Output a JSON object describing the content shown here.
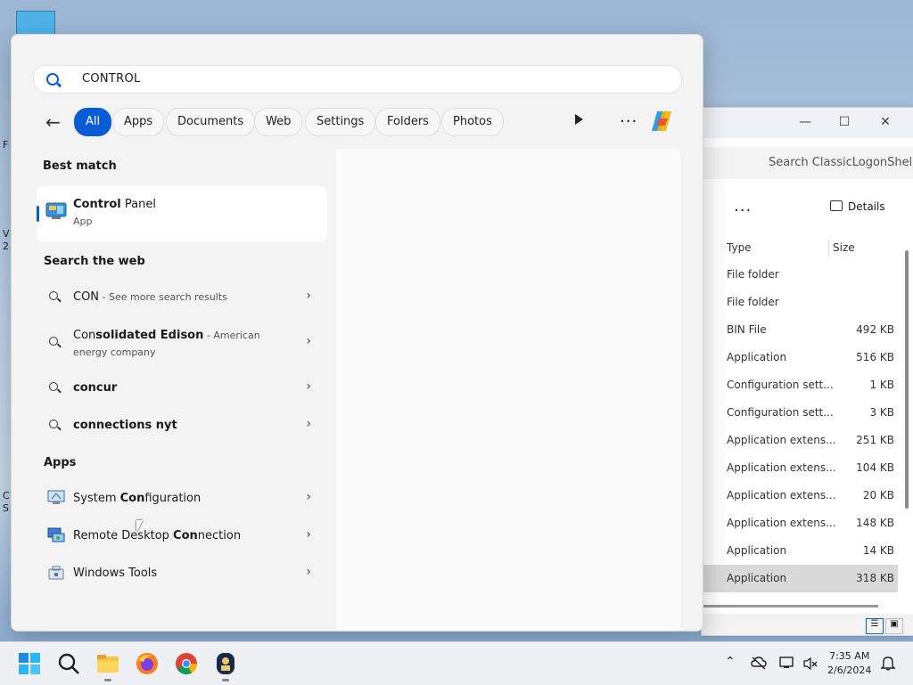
{
  "desktop": {
    "frag1": "F",
    "frag2": "V",
    "frag3": "2",
    "frag4": "C",
    "frag5": "S"
  },
  "explorer": {
    "search_placeholder": "Search ClassicLogonShell",
    "more_label": "...",
    "details_label": "Details",
    "col_type": "Type",
    "col_size": "Size",
    "rows": [
      {
        "type": "File folder",
        "size": ""
      },
      {
        "type": "File folder",
        "size": ""
      },
      {
        "type": "BIN File",
        "size": "492 KB"
      },
      {
        "type": "Application",
        "size": "516 KB"
      },
      {
        "type": "Configuration sett...",
        "size": "1 KB"
      },
      {
        "type": "Configuration sett...",
        "size": "3 KB"
      },
      {
        "type": "Application extens...",
        "size": "251 KB"
      },
      {
        "type": "Application extens...",
        "size": "104 KB"
      },
      {
        "type": "Application extens...",
        "size": "20 KB"
      },
      {
        "type": "Application extens...",
        "size": "148 KB"
      },
      {
        "type": "Application",
        "size": "14 KB"
      },
      {
        "type": "Application",
        "size": "318 KB"
      }
    ]
  },
  "search": {
    "query": "CONTROL",
    "filters": [
      "All",
      "Apps",
      "Documents",
      "Web",
      "Settings",
      "Folders",
      "Photos"
    ],
    "more_label": "..."
  },
  "best_match": {
    "title": "Best match",
    "name_bold": "Control",
    "name_rest": " Panel",
    "sub": "App"
  },
  "web": {
    "title": "Search the web",
    "items": [
      {
        "bold": "CON",
        "rest": "",
        "muted": " - See more search results",
        "line2": ""
      },
      {
        "bold": "Con",
        "rest": "solidated Edison",
        "muted": " - American",
        "line2": "energy company"
      },
      {
        "bold": "",
        "rest": "concur",
        "muted": "",
        "line2": ""
      },
      {
        "bold": "",
        "rest": "connections nyt",
        "muted": "",
        "line2": ""
      }
    ]
  },
  "apps": {
    "title": "Apps",
    "items": [
      {
        "pre": "System ",
        "bold": "Con",
        "post": "figuration"
      },
      {
        "pre": "Remote Desktop ",
        "bold": "Con",
        "post": "nection"
      },
      {
        "pre": "Windows Tools",
        "bold": "",
        "post": ""
      }
    ]
  },
  "taskbar": {
    "time": "7:35 AM",
    "date": "2/6/2024"
  },
  "colors": {
    "accent": "#0a5bd6"
  }
}
